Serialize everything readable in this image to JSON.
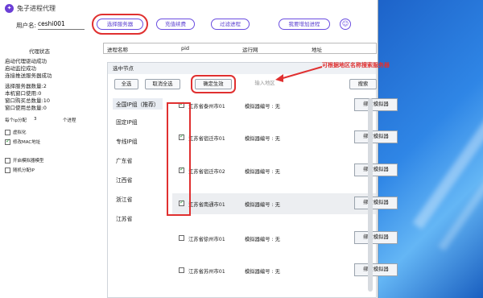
{
  "app": {
    "title": "兔子进程代理",
    "icon_glyph": "✦"
  },
  "topbar": {
    "user_label": "用户名:",
    "username": "ceshi001",
    "buttons": [
      "选择服务器",
      "充值续费",
      "过滤进程",
      "我要增加进程"
    ],
    "avatar_glyph": "☺"
  },
  "sidebar": {
    "status_head": "代理状态",
    "status_lines": [
      "启动代理驱动成功",
      "启动监控成功",
      "连接推送服务器成功"
    ],
    "stats": [
      "选择服务器数量:2",
      "本机窗口使用:0",
      "窗口购买总数量:10",
      "窗口使用总数量:0"
    ],
    "per_ip_label": "每个ip分配",
    "per_ip_value": "3",
    "per_ip_unit": "个进程",
    "options": [
      {
        "label": "虚拟化",
        "checked": false
      },
      {
        "label": "修改MAC地址",
        "checked": true
      },
      {
        "label": "开启模拟器模型",
        "checked": false
      },
      {
        "label": "随机分配IP",
        "checked": false
      }
    ]
  },
  "process_table": {
    "columns": [
      "进程名称",
      "pid",
      "运行网",
      "地址"
    ]
  },
  "panel": {
    "header": "选中节点",
    "btn_select_all": "全选",
    "btn_cancel_all": "取消全选",
    "btn_confirm": "确定生效",
    "search_placeholder": "输入地区",
    "btn_search": "搜索",
    "regions": [
      "全国IP组（推荐）",
      "固定IP组",
      "专线IP组",
      "广东省",
      "江西省",
      "浙江省",
      "江苏省"
    ],
    "rows": [
      {
        "name": "江苏省泰州市01",
        "num": "模拟器编号 : 无",
        "checked": true,
        "bind": "绑定模拟器"
      },
      {
        "name": "江苏省宿迁市01",
        "num": "模拟器编号 : 无",
        "checked": true,
        "bind": "绑定模拟器"
      },
      {
        "name": "江苏省宿迁市02",
        "num": "模拟器编号 : 无",
        "checked": true,
        "bind": "绑定模拟器"
      },
      {
        "name": "江苏省南通市01",
        "num": "模拟器编号 : 无",
        "checked": true,
        "bind": "绑定模拟器"
      },
      {
        "name": "江苏省徐州市01",
        "num": "模拟器编号 : 无",
        "checked": false,
        "bind": "绑定模拟器"
      },
      {
        "name": "江苏省苏州市01",
        "num": "模拟器编号 : 无",
        "checked": false,
        "bind": "绑定模拟器"
      }
    ]
  },
  "annotation": "可根据地区名称搜索服务器",
  "colors": {
    "accent": "#6a4de0",
    "annotation": "#e03030",
    "desktop": "#2f86e6"
  }
}
